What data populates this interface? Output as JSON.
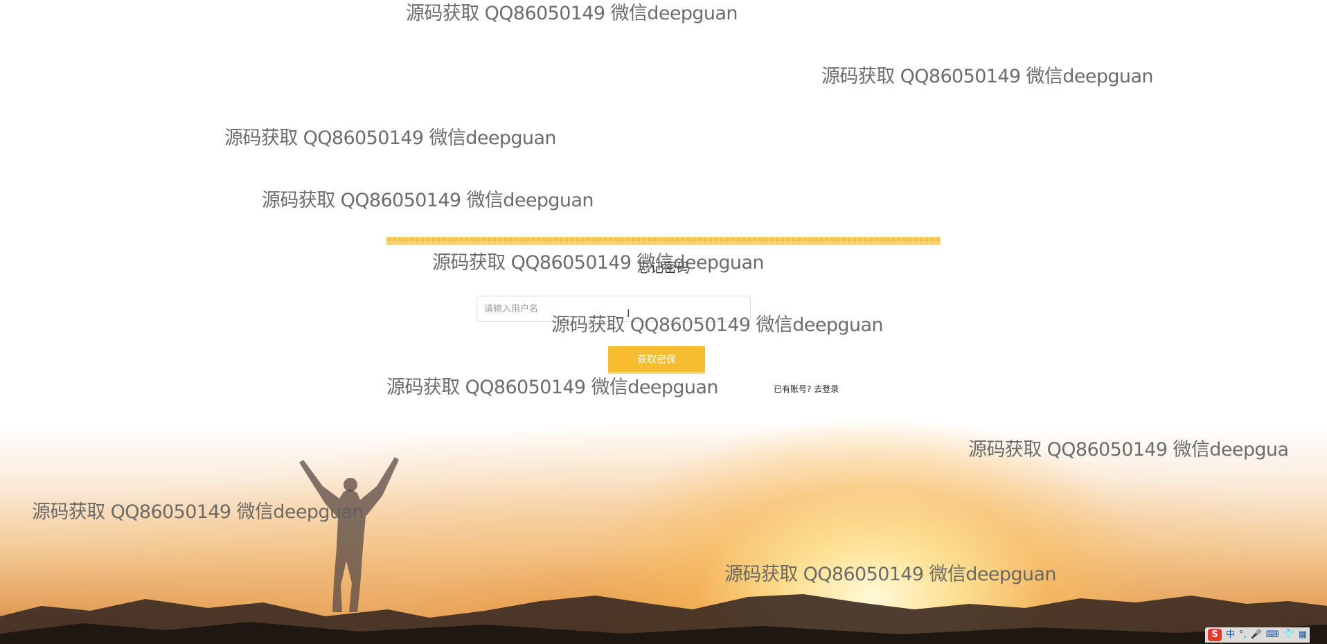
{
  "form": {
    "title": "忘记密码",
    "username_placeholder": "请输入用户名",
    "username_value": "",
    "submit_label": "获取密保",
    "login_prompt": "已有账号?",
    "login_link": "去登录"
  },
  "watermark": {
    "text": "源码获取 QQ86050149 微信deepguan",
    "text_clipped": "源码获取 QQ86050149 微信deepgua"
  },
  "ime_toolbar": {
    "logo": "S",
    "lang": "中",
    "items": [
      "°,",
      "🎤",
      "⌨",
      "👕",
      "▦"
    ]
  },
  "colors": {
    "accent": "#f5bd2f",
    "headband": "#f7d26e",
    "watermark": "#5f5f5f"
  }
}
